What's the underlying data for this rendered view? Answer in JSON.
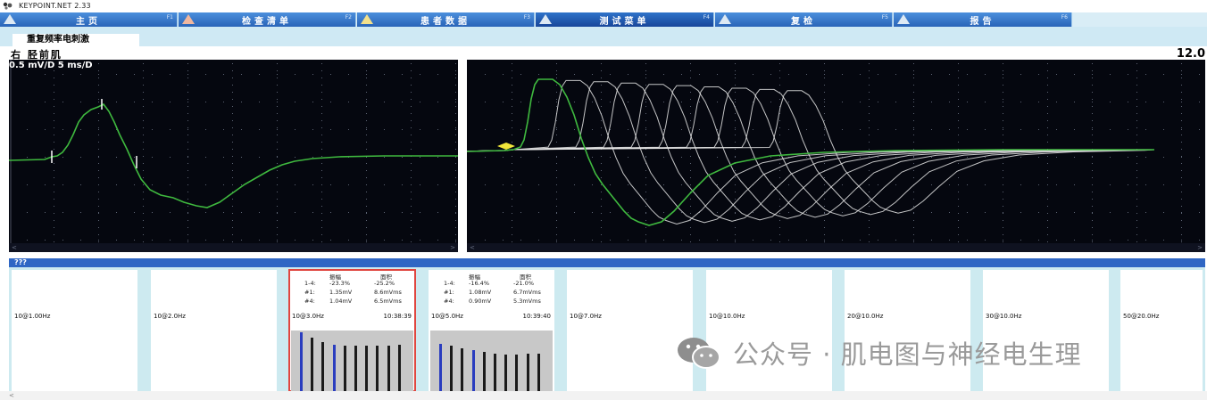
{
  "app": {
    "title": "KEYPOINT.NET 2.33"
  },
  "menu": {
    "tabs": [
      {
        "label": "主页",
        "fkey": "F1",
        "icon": "triangle-icon",
        "active": false
      },
      {
        "label": "检查清单",
        "fkey": "F2",
        "icon": "triangle-icon",
        "active": false
      },
      {
        "label": "患者数据",
        "fkey": "F3",
        "icon": "triangle-icon",
        "active": false
      },
      {
        "label": "测试菜单",
        "fkey": "F4",
        "icon": "triangle-icon",
        "active": true
      },
      {
        "label": "复检",
        "fkey": "F5",
        "icon": "triangle-icon",
        "active": false
      },
      {
        "label": "报告",
        "fkey": "F6",
        "icon": "triangle-icon",
        "active": false
      }
    ]
  },
  "section": {
    "tab_label": "重复频率电刺激"
  },
  "recording": {
    "muscle": "右 胫前肌",
    "gain_sweep": "0.5 mV/D 5 ms/D",
    "time_readout": "12.0"
  },
  "results": {
    "header": "???",
    "trials": [
      {
        "label": "10@1.00Hz",
        "time": "",
        "has_stats": false
      },
      {
        "label": "10@2.0Hz",
        "time": "",
        "has_stats": false
      },
      {
        "label": "10@3.0Hz",
        "time": "10:38:39",
        "has_stats": true,
        "selected": true,
        "stats": {
          "col_amp": "振幅",
          "col_area": "面积",
          "rows": [
            {
              "k": "1-4:",
              "a": "-23.3%",
              "b": "-25.2%"
            },
            {
              "k": "#1:",
              "a": "1.35mV",
              "b": "8.6mVms"
            },
            {
              "k": "#4:",
              "a": "1.04mV",
              "b": "6.5mVms"
            }
          ]
        },
        "bar_levels": [
          1.0,
          0.91,
          0.84,
          0.79,
          0.77,
          0.77,
          0.77,
          0.78,
          0.78,
          0.79
        ]
      },
      {
        "label": "10@5.0Hz",
        "time": "10:39:40",
        "has_stats": true,
        "selected": false,
        "stats": {
          "col_amp": "振幅",
          "col_area": "面积",
          "rows": [
            {
              "k": "1-4:",
              "a": "-16.4%",
              "b": "-21.0%"
            },
            {
              "k": "#1:",
              "a": "1.08mV",
              "b": "6.7mVms"
            },
            {
              "k": "#4:",
              "a": "0.90mV",
              "b": "5.3mVms"
            }
          ]
        },
        "bar_levels": [
          0.81,
          0.77,
          0.73,
          0.69,
          0.66,
          0.64,
          0.62,
          0.62,
          0.63,
          0.64
        ]
      },
      {
        "label": "10@7.0Hz",
        "time": "",
        "has_stats": false
      },
      {
        "label": "10@10.0Hz",
        "time": "",
        "has_stats": false
      },
      {
        "label": "20@10.0Hz",
        "time": "",
        "has_stats": false
      },
      {
        "label": "30@10.0Hz",
        "time": "",
        "has_stats": false
      },
      {
        "label": "50@20.0Hz",
        "time": "",
        "has_stats": false
      }
    ]
  },
  "watermark": {
    "text": "公众号 · 肌电图与神经电生理",
    "icon": "wechat-icon"
  },
  "colors": {
    "trace_green": "#3fb93f",
    "trace_white": "#e6e6e6",
    "panel_bg": "#05070f",
    "menu_blue": "#2a64b8",
    "selected_outline": "#e0463f",
    "bar_blue": "#2a3dbf"
  }
}
